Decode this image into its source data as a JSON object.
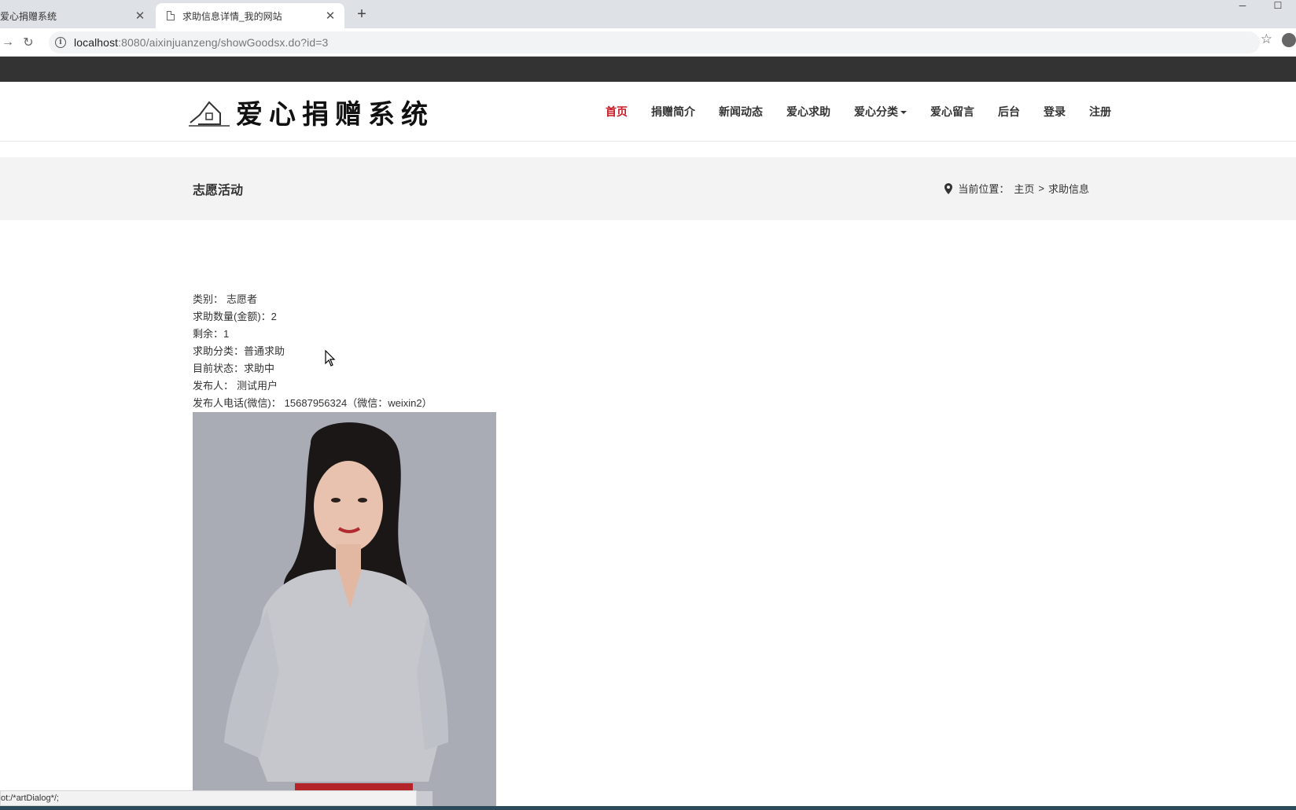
{
  "browser": {
    "tabs": [
      {
        "title": "爱心捐赠系统",
        "active": false
      },
      {
        "title": "求助信息详情_我的网站",
        "active": true
      }
    ],
    "url_host": "localhost",
    "url_rest": ":8080/aixinjuanzeng/showGoodsx.do?id=3",
    "status_text": "ot:/*artDialog*/;"
  },
  "site": {
    "logo_text": "爱心捐赠系统",
    "menu": [
      {
        "label": "首页",
        "active": true
      },
      {
        "label": "捐赠简介",
        "active": false
      },
      {
        "label": "新闻动态",
        "active": false
      },
      {
        "label": "爱心求助",
        "active": false
      },
      {
        "label": "爱心分类",
        "active": false,
        "dropdown": true
      },
      {
        "label": "爱心留言",
        "active": false
      },
      {
        "label": "后台",
        "active": false
      },
      {
        "label": "登录",
        "active": false
      },
      {
        "label": "注册",
        "active": false
      }
    ],
    "accent_color": "#c81623"
  },
  "title_bar": {
    "section_title": "志愿活动",
    "breadcrumb_prefix": "当前位置：",
    "breadcrumb_home": "主页",
    "breadcrumb_sep": ">",
    "breadcrumb_current": "求助信息"
  },
  "detail": {
    "category_label": "类别：",
    "category_value": "志愿者",
    "quantity_label": "求助数量(金额)：",
    "quantity_value": "2",
    "remaining_label": "剩余：",
    "remaining_value": "1",
    "type_label": "求助分类：",
    "type_value": "普通求助",
    "status_label": "目前状态：",
    "status_value": "求助中",
    "publisher_label": "发布人：",
    "publisher_value": "测试用户",
    "phone_label": "发布人电话(微信)：",
    "phone_value": "15687956324（微信：weixin2）"
  }
}
